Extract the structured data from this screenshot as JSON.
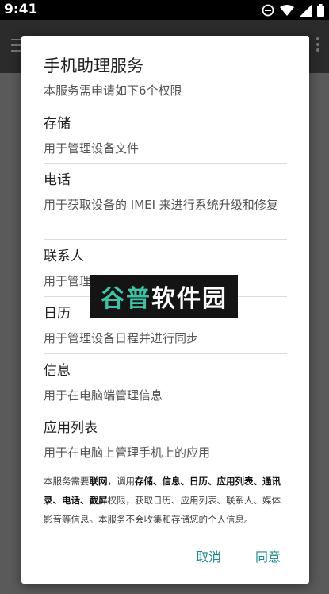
{
  "status_bar": {
    "time": "9:41"
  },
  "dialog": {
    "title": "手机助理服务",
    "subtitle": "本服务需申请如下6个权限",
    "permissions": [
      {
        "name": "存储",
        "desc": "用于管理设备文件"
      },
      {
        "name": "电话",
        "desc": "用于获取设备的 IMEI 来进行系统升级和修复"
      },
      {
        "name": "联系人",
        "desc": "用于管理设备联系人并进行同步"
      },
      {
        "name": "日历",
        "desc": "用于管理设备日程并进行同步"
      },
      {
        "name": "信息",
        "desc": "用于在电脑端管理信息"
      },
      {
        "name": "应用列表",
        "desc": "用于在电脑上管理手机上的应用"
      }
    ],
    "note": {
      "p1": "本服务需要",
      "b1": "联网",
      "p2": "，调用",
      "b2": "存储、信息、日历、应用列表、通讯录、电话、截屏",
      "p3": "权限，获取日历、应用列表、联系人、媒体影音等信息。本服务不会收集和存储您的个人信息。"
    },
    "cancel_label": "取消",
    "agree_label": "同意"
  },
  "watermark": {
    "text_1": "谷普",
    "text_2": "软件园"
  },
  "colors": {
    "accent": "#1a8a8a",
    "statusbar": "#000000",
    "appbar": "#2b2b2b",
    "scrim": "#5a5a5a"
  }
}
